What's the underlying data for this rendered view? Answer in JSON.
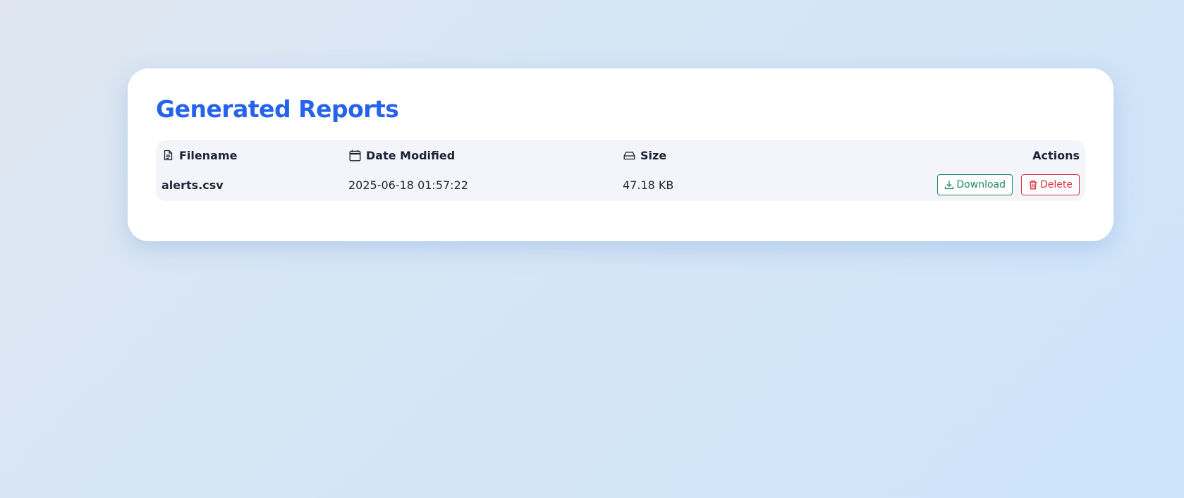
{
  "page": {
    "title": "Generated Reports"
  },
  "table": {
    "columns": [
      {
        "label": "Filename",
        "icon": "file-icon"
      },
      {
        "label": "Date Modified",
        "icon": "calendar-icon"
      },
      {
        "label": "Size",
        "icon": "hard-drive-icon"
      },
      {
        "label": "Actions"
      }
    ],
    "rows": [
      {
        "filename": "alerts.csv",
        "date_modified": "2025-06-18 01:57:22",
        "size": "47.18 KB",
        "actions": {
          "download_label": "Download",
          "download_icon": "download-icon",
          "delete_label": "Delete",
          "delete_icon": "trash-icon"
        }
      }
    ]
  },
  "colors": {
    "title": "#2563eb",
    "download": "#1f8a5b",
    "delete": "#dc2d3c",
    "table_bg": "#f3f5fa"
  }
}
